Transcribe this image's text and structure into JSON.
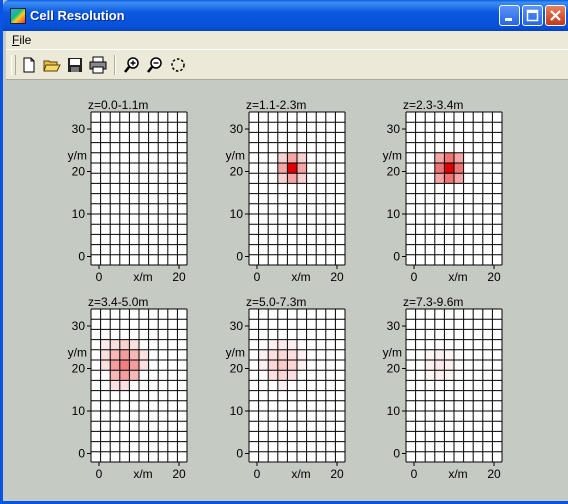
{
  "window": {
    "title": "Cell Resolution"
  },
  "menu": {
    "file_label": "File",
    "file_mnemonic": "F",
    "file_rest": "ile"
  },
  "toolbar": {
    "items": [
      "new-document-icon",
      "open-folder-icon",
      "save-disk-icon",
      "print-icon",
      "zoom-in-icon",
      "zoom-out-icon",
      "zoom-reset-icon"
    ]
  },
  "colors": {
    "title_bar": "#0A54E4",
    "client_bg": "#C5CAC3",
    "peak_red": "#E00000"
  },
  "chart_data": {
    "type": "heatmap",
    "grid": {
      "nx": 10,
      "ny": 15
    },
    "xlim": [
      -2,
      22
    ],
    "ylim": [
      -2,
      34
    ],
    "xticks": [
      0,
      20
    ],
    "yticks": [
      0,
      10,
      20,
      30
    ],
    "xlabel": "x/m",
    "ylabel": "y/m",
    "panels": [
      {
        "title": "z=0.0-1.1m",
        "cells": []
      },
      {
        "title": "z=1.1-2.3m",
        "cells": [
          {
            "col": 3,
            "row": 4,
            "v": 0.18
          },
          {
            "col": 4,
            "row": 4,
            "v": 0.35
          },
          {
            "col": 5,
            "row": 4,
            "v": 0.18
          },
          {
            "col": 3,
            "row": 5,
            "v": 0.35
          },
          {
            "col": 4,
            "row": 5,
            "v": 1.0
          },
          {
            "col": 5,
            "row": 5,
            "v": 0.35
          },
          {
            "col": 3,
            "row": 6,
            "v": 0.18
          },
          {
            "col": 4,
            "row": 6,
            "v": 0.35
          },
          {
            "col": 5,
            "row": 6,
            "v": 0.18
          }
        ]
      },
      {
        "title": "z=2.3-3.4m",
        "cells": [
          {
            "col": 3,
            "row": 4,
            "v": 0.35
          },
          {
            "col": 4,
            "row": 4,
            "v": 0.55
          },
          {
            "col": 5,
            "row": 4,
            "v": 0.35
          },
          {
            "col": 3,
            "row": 5,
            "v": 0.55
          },
          {
            "col": 4,
            "row": 5,
            "v": 1.0
          },
          {
            "col": 5,
            "row": 5,
            "v": 0.55
          },
          {
            "col": 3,
            "row": 6,
            "v": 0.35
          },
          {
            "col": 4,
            "row": 6,
            "v": 0.55
          },
          {
            "col": 5,
            "row": 6,
            "v": 0.35
          }
        ]
      },
      {
        "title": "z=3.4-5.0m",
        "cells": [
          {
            "col": 1,
            "row": 3,
            "v": 0.08
          },
          {
            "col": 2,
            "row": 3,
            "v": 0.12
          },
          {
            "col": 3,
            "row": 3,
            "v": 0.18
          },
          {
            "col": 4,
            "row": 3,
            "v": 0.12
          },
          {
            "col": 1,
            "row": 4,
            "v": 0.12
          },
          {
            "col": 2,
            "row": 4,
            "v": 0.28
          },
          {
            "col": 3,
            "row": 4,
            "v": 0.38
          },
          {
            "col": 4,
            "row": 4,
            "v": 0.28
          },
          {
            "col": 5,
            "row": 4,
            "v": 0.12
          },
          {
            "col": 1,
            "row": 5,
            "v": 0.12
          },
          {
            "col": 2,
            "row": 5,
            "v": 0.38
          },
          {
            "col": 3,
            "row": 5,
            "v": 0.5
          },
          {
            "col": 4,
            "row": 5,
            "v": 0.38
          },
          {
            "col": 5,
            "row": 5,
            "v": 0.12
          },
          {
            "col": 2,
            "row": 6,
            "v": 0.28
          },
          {
            "col": 3,
            "row": 6,
            "v": 0.38
          },
          {
            "col": 4,
            "row": 6,
            "v": 0.28
          },
          {
            "col": 2,
            "row": 7,
            "v": 0.12
          },
          {
            "col": 3,
            "row": 7,
            "v": 0.12
          }
        ]
      },
      {
        "title": "z=5.0-7.3m",
        "cells": [
          {
            "col": 2,
            "row": 3,
            "v": 0.06
          },
          {
            "col": 3,
            "row": 3,
            "v": 0.08
          },
          {
            "col": 4,
            "row": 3,
            "v": 0.06
          },
          {
            "col": 1,
            "row": 4,
            "v": 0.06
          },
          {
            "col": 2,
            "row": 4,
            "v": 0.12
          },
          {
            "col": 3,
            "row": 4,
            "v": 0.16
          },
          {
            "col": 4,
            "row": 4,
            "v": 0.12
          },
          {
            "col": 5,
            "row": 4,
            "v": 0.06
          },
          {
            "col": 1,
            "row": 5,
            "v": 0.06
          },
          {
            "col": 2,
            "row": 5,
            "v": 0.16
          },
          {
            "col": 3,
            "row": 5,
            "v": 0.2
          },
          {
            "col": 4,
            "row": 5,
            "v": 0.16
          },
          {
            "col": 5,
            "row": 5,
            "v": 0.06
          },
          {
            "col": 2,
            "row": 6,
            "v": 0.12
          },
          {
            "col": 3,
            "row": 6,
            "v": 0.16
          },
          {
            "col": 4,
            "row": 6,
            "v": 0.12
          },
          {
            "col": 3,
            "row": 7,
            "v": 0.06
          }
        ]
      },
      {
        "title": "z=7.3-9.6m",
        "cells": [
          {
            "col": 2,
            "row": 4,
            "v": 0.04
          },
          {
            "col": 3,
            "row": 4,
            "v": 0.06
          },
          {
            "col": 4,
            "row": 4,
            "v": 0.04
          },
          {
            "col": 2,
            "row": 5,
            "v": 0.06
          },
          {
            "col": 3,
            "row": 5,
            "v": 0.08
          },
          {
            "col": 4,
            "row": 5,
            "v": 0.06
          },
          {
            "col": 2,
            "row": 6,
            "v": 0.04
          },
          {
            "col": 3,
            "row": 6,
            "v": 0.06
          },
          {
            "col": 4,
            "row": 6,
            "v": 0.04
          }
        ]
      }
    ]
  }
}
